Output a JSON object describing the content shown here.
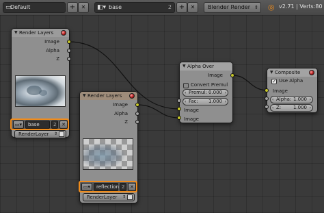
{
  "topbar": {
    "scene_name": "Default",
    "scene_add": "+",
    "scene_close": "✕",
    "layer_name": "base",
    "layer_count": "2",
    "layer_add": "+",
    "layer_close": "✕",
    "engine": "Blender Render",
    "version": "v2.71 | Verts:80"
  },
  "nodes": {
    "render_layers_1": {
      "title": "Render Layers",
      "outputs": [
        "Image",
        "Alpha",
        "Z"
      ],
      "scene_field": "base",
      "users_count": "2",
      "close": "✕",
      "layer_select": "RenderLayer"
    },
    "render_layers_2": {
      "title": "Render Layers",
      "outputs": [
        "Image",
        "Alpha",
        "Z"
      ],
      "scene_field": "reflection",
      "users_count": "2",
      "close": "✕",
      "layer_select": "RenderLayer"
    },
    "alpha_over": {
      "title": "Alpha Over",
      "output": "Image",
      "convert_premul": "Convert Premul",
      "premul_label": "Premul:",
      "premul_value": "0.000",
      "fac_label": "Fac:",
      "fac_value": "1.000",
      "inputs": [
        "Image",
        "Image"
      ]
    },
    "composite": {
      "title": "Composite",
      "use_alpha": "Use Alpha",
      "input": "Image",
      "alpha_label": "Alpha:",
      "alpha_value": "1.000",
      "z_label": "Z:",
      "z_value": "1.000"
    }
  },
  "colors": {
    "socket_color": "#c7c729",
    "socket_value": "#a1a1a1",
    "selection_highlight": "#f08c1c",
    "node_body": "#8f8f8f",
    "node_header_active": "#a3a3a3"
  },
  "icons": {
    "scene": "scene-icon",
    "render_layers": "render-layers-icon",
    "blender": "blender-logo-icon"
  }
}
